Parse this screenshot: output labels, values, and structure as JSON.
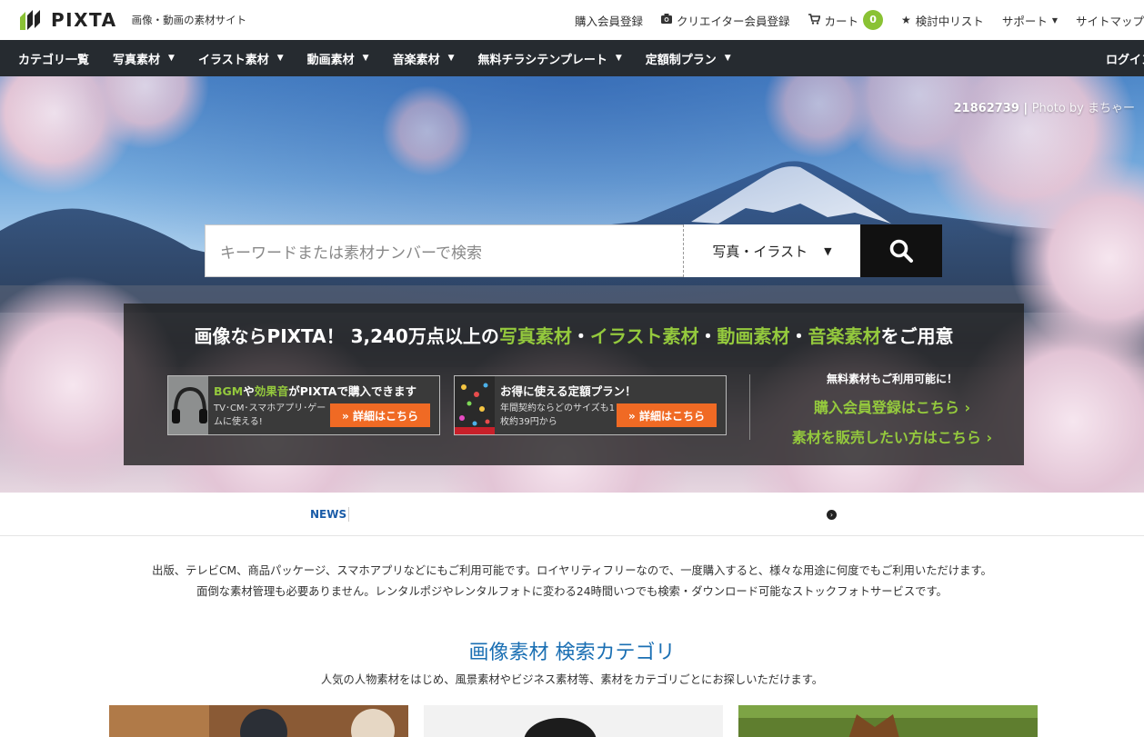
{
  "header": {
    "brand": "PIXTA",
    "tagline": "画像・動画の素材サイト",
    "nav": {
      "register": "購入会員登録",
      "creator": "クリエイター会員登録",
      "cart": "カート",
      "cart_count": "0",
      "favorites": "検討中リスト",
      "support": "サポート",
      "sitemap": "サイトマップ"
    }
  },
  "category_nav": {
    "items": [
      "カテゴリ一覧",
      "写真素材",
      "イラスト素材",
      "動画素材",
      "音楽素材",
      "無料チラシテンプレート",
      "定額制プラン"
    ],
    "login": "ログイン"
  },
  "hero": {
    "credit_id": "21862739",
    "credit_sep": "|",
    "credit_by": "Photo by まちゃー",
    "search": {
      "placeholder": "キーワードまたは素材ナンバーで検索",
      "type": "写真・イラスト"
    },
    "promo": {
      "head_pre": "画像ならPIXTA！ 3,240万点以上の",
      "head_photo": "写真素材",
      "dot": "・",
      "head_illust": "イラスト素材",
      "head_video": "動画素材",
      "head_music": "音楽素材",
      "head_post": "をご用意",
      "card1": {
        "bgm": "BGM",
        "ya": "や",
        "se": "効果音",
        "rest": "がPIXTAで購入できます",
        "desc": "TV･CM･スマホアプリ･ゲームに使える!",
        "button": "» 詳細はこちら"
      },
      "card2": {
        "title": "お得に使える定額プラン！",
        "desc": "年間契約ならどのサイズも1枚約39円から",
        "button": "» 詳細はこちら"
      },
      "free_note": "無料素材もご利用可能に！",
      "register_link": "購入会員登録はこちら ›",
      "sell_link": "素材を販売したい方はこちら ›"
    }
  },
  "news": {
    "label": "NEWS"
  },
  "intro": {
    "line1": "出版、テレビCM、商品パッケージ、スマホアプリなどにもご利用可能です。ロイヤリティフリーなので、一度購入すると、様々な用途に何度でもご利用いただけます。",
    "line2": "面倒な素材管理も必要ありません。レンタルポジやレンタルフォトに変わる24時間いつでも検索・ダウンロード可能なストックフォトサービスです。"
  },
  "category_section": {
    "title": "画像素材 検索カテゴリ",
    "subtitle": "人気の人物素材をはじめ、風景素材やビジネス素材等、素材をカテゴリごとにお探しいただけます。"
  },
  "colors": {
    "accent_green": "#94c93d",
    "nav_dark": "#262b30",
    "title_blue": "#1a6fb3",
    "button_orange": "#f06a24"
  }
}
